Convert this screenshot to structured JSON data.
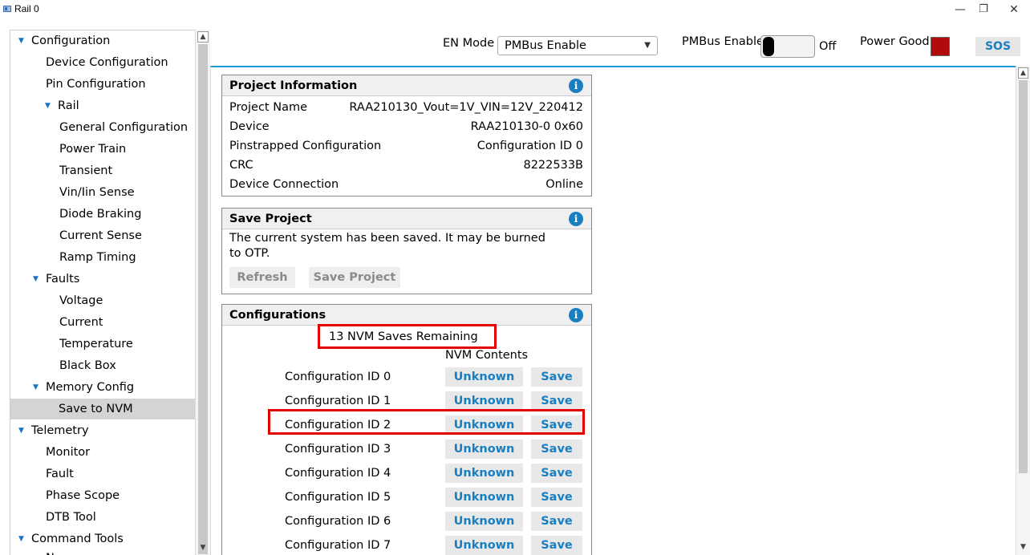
{
  "window": {
    "title": "Rail 0",
    "minimize": "—",
    "restore": "❐",
    "close": "✕"
  },
  "sidebar": {
    "items": [
      {
        "label": "Configuration",
        "arrow": "▼"
      },
      {
        "label": "Device Configuration"
      },
      {
        "label": "Pin Configuration"
      },
      {
        "label": "Rail",
        "arrow": "▼"
      },
      {
        "label": "General Configuration"
      },
      {
        "label": "Power Train"
      },
      {
        "label": "Transient"
      },
      {
        "label": "Vin/Iin Sense"
      },
      {
        "label": "Diode Braking"
      },
      {
        "label": "Current Sense"
      },
      {
        "label": "Ramp Timing"
      },
      {
        "label": "Faults",
        "arrow": "▼"
      },
      {
        "label": "Voltage"
      },
      {
        "label": "Current"
      },
      {
        "label": "Temperature"
      },
      {
        "label": "Black Box"
      },
      {
        "label": "Memory Config",
        "arrow": "▼"
      },
      {
        "label": "Save to NVM",
        "selected": true
      },
      {
        "label": "Telemetry",
        "arrow": "▼"
      },
      {
        "label": "Monitor"
      },
      {
        "label": "Fault"
      },
      {
        "label": "Phase Scope"
      },
      {
        "label": "DTB Tool"
      },
      {
        "label": "Command Tools",
        "arrow": "▼"
      },
      {
        "label": "N..."
      }
    ]
  },
  "topbar": {
    "en_mode_label": "EN Mode",
    "en_mode_value": "PMBus Enable",
    "pmbus_enable_label": "PMBus Enable",
    "pmbus_enable_state": "Off",
    "power_good_label": "Power Good",
    "power_good_color": "#b10b0b",
    "sos_label": "SOS"
  },
  "project_info": {
    "title": "Project Information",
    "rows": [
      {
        "label": "Project Name",
        "value": "RAA210130_Vout=1V_VIN=12V_220412"
      },
      {
        "label": "Device",
        "value": "RAA210130-0 0x60"
      },
      {
        "label": "Pinstrapped Configuration",
        "value": "Configuration ID 0"
      },
      {
        "label": "CRC",
        "value": "8222533B"
      },
      {
        "label": "Device Connection",
        "value": "Online"
      }
    ]
  },
  "save_project": {
    "title": "Save Project",
    "message_line1": "The current system has been saved. It may be burned",
    "message_line2": "to OTP.",
    "refresh_label": "Refresh",
    "save_label": "Save Project"
  },
  "configurations": {
    "title": "Configurations",
    "saves_remaining": "13 NVM Saves Remaining",
    "nvm_contents_header": "NVM Contents",
    "rows": [
      {
        "label": "Configuration ID 0",
        "status": "Unknown",
        "action": "Save"
      },
      {
        "label": "Configuration ID 1",
        "status": "Unknown",
        "action": "Save"
      },
      {
        "label": "Configuration ID 2",
        "status": "Unknown",
        "action": "Save"
      },
      {
        "label": "Configuration ID 3",
        "status": "Unknown",
        "action": "Save"
      },
      {
        "label": "Configuration ID 4",
        "status": "Unknown",
        "action": "Save"
      },
      {
        "label": "Configuration ID 5",
        "status": "Unknown",
        "action": "Save"
      },
      {
        "label": "Configuration ID 6",
        "status": "Unknown",
        "action": "Save"
      },
      {
        "label": "Configuration ID 7",
        "status": "Unknown",
        "action": "Save"
      }
    ]
  },
  "colors": {
    "accent": "#1a7fc0",
    "highlight": "#e50000",
    "header_line": "#1a9ad6"
  }
}
